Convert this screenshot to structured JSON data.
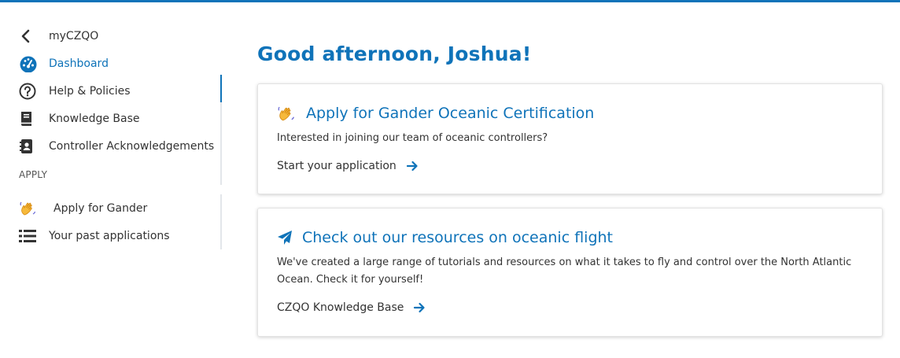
{
  "sidebar": {
    "back_label": "myCZQO",
    "items": [
      {
        "label": "Dashboard",
        "icon": "dashboard-icon",
        "active": true
      },
      {
        "label": "Help & Policies",
        "icon": "question-circle-icon"
      },
      {
        "label": "Knowledge Base",
        "icon": "book-icon"
      },
      {
        "label": "Controller Acknowledgements",
        "icon": "contact-card-icon"
      }
    ],
    "apply_section": "APPLY",
    "apply_items": [
      {
        "label": "Apply for Gander",
        "icon": "waving-hand-icon"
      },
      {
        "label": "Your past applications",
        "icon": "list-icon"
      }
    ]
  },
  "main": {
    "greeting": "Good afternoon, Joshua!",
    "cards": [
      {
        "title": "Apply for Gander Oceanic Certification",
        "icon": "waving-hand-icon",
        "text": "Interested in joining our team of oceanic controllers?",
        "link": "Start your application"
      },
      {
        "title": "Check out our resources on oceanic flight",
        "icon": "paper-plane-icon",
        "text": "We've created a large range of tutorials and resources on what it takes to fly and control over the North Atlantic Ocean. Check it for yourself!",
        "link": "CZQO Knowledge Base"
      }
    ]
  },
  "colors": {
    "accent": "#0f73b9",
    "text": "#333333"
  }
}
